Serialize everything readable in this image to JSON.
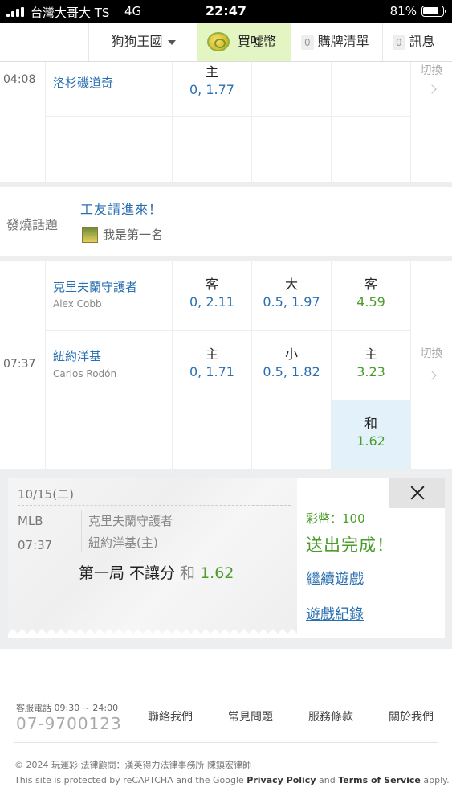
{
  "status_bar": {
    "carrier": "台灣大哥大 TS",
    "network": "4G",
    "time": "22:47",
    "battery": "81%"
  },
  "nav": {
    "kingdom": "狗狗王國",
    "buy_coins": "買噓幣",
    "cart_count": "0",
    "cart": "購牌清單",
    "msg_count": "0",
    "messages": "訊息"
  },
  "game1": {
    "time": "04:08",
    "team": "洛杉磯道奇",
    "odd_label": "主",
    "odd_value": "0, 1.77",
    "switch": "切換"
  },
  "hot_topics": {
    "label": "發燒話題",
    "title": "工友請進來！",
    "subtitle": "我是第一名"
  },
  "game2": {
    "time": "07:37",
    "away_team": "克里夫蘭守護者",
    "away_pitcher": "Alex Cobb",
    "home_team": "紐約洋基",
    "home_pitcher": "Carlos Rodón",
    "switch": "切換",
    "away_spread_label": "客",
    "away_spread_value": "0, 2.11",
    "over_label": "大",
    "over_value": "0.5, 1.97",
    "away_ml_label": "客",
    "away_ml_value": "4.59",
    "home_spread_label": "主",
    "home_spread_value": "0, 1.71",
    "under_label": "小",
    "under_value": "0.5, 1.82",
    "home_ml_label": "主",
    "home_ml_value": "3.23",
    "draw_label": "和",
    "draw_value": "1.62"
  },
  "ticket": {
    "date": "10/15(二)",
    "league": "MLB",
    "time": "07:37",
    "team1": "克里夫蘭守護者",
    "team2": "紐約洋基(主)",
    "bet": "第一局 不讓分",
    "pick": "和",
    "odds": "1.62"
  },
  "result": {
    "coins": "彩幣：100",
    "status": "送出完成！",
    "continue": "繼續遊戲",
    "history": "遊戲紀錄"
  },
  "footer": {
    "phone_label": "客服電話 09:30 ~ 24:00",
    "phone": "07-9700123",
    "links": [
      "聯絡我們",
      "常見問題",
      "服務條款",
      "關於我們"
    ],
    "copyright": "© 2024 玩運彩 法律顧問：漢英得力法律事務所 陳鎮宏律師",
    "recaptcha_pre": "This site is protected by reCAPTCHA and the Google ",
    "privacy": "Privacy Policy",
    "and": " and ",
    "terms": "Terms of Service",
    "apply": " apply."
  },
  "colors": {
    "link_blue": "#2a6fb0",
    "odds_green": "#4a9d2a",
    "buy_bg": "#e3f5c2",
    "draw_bg": "#e3f1fb"
  }
}
